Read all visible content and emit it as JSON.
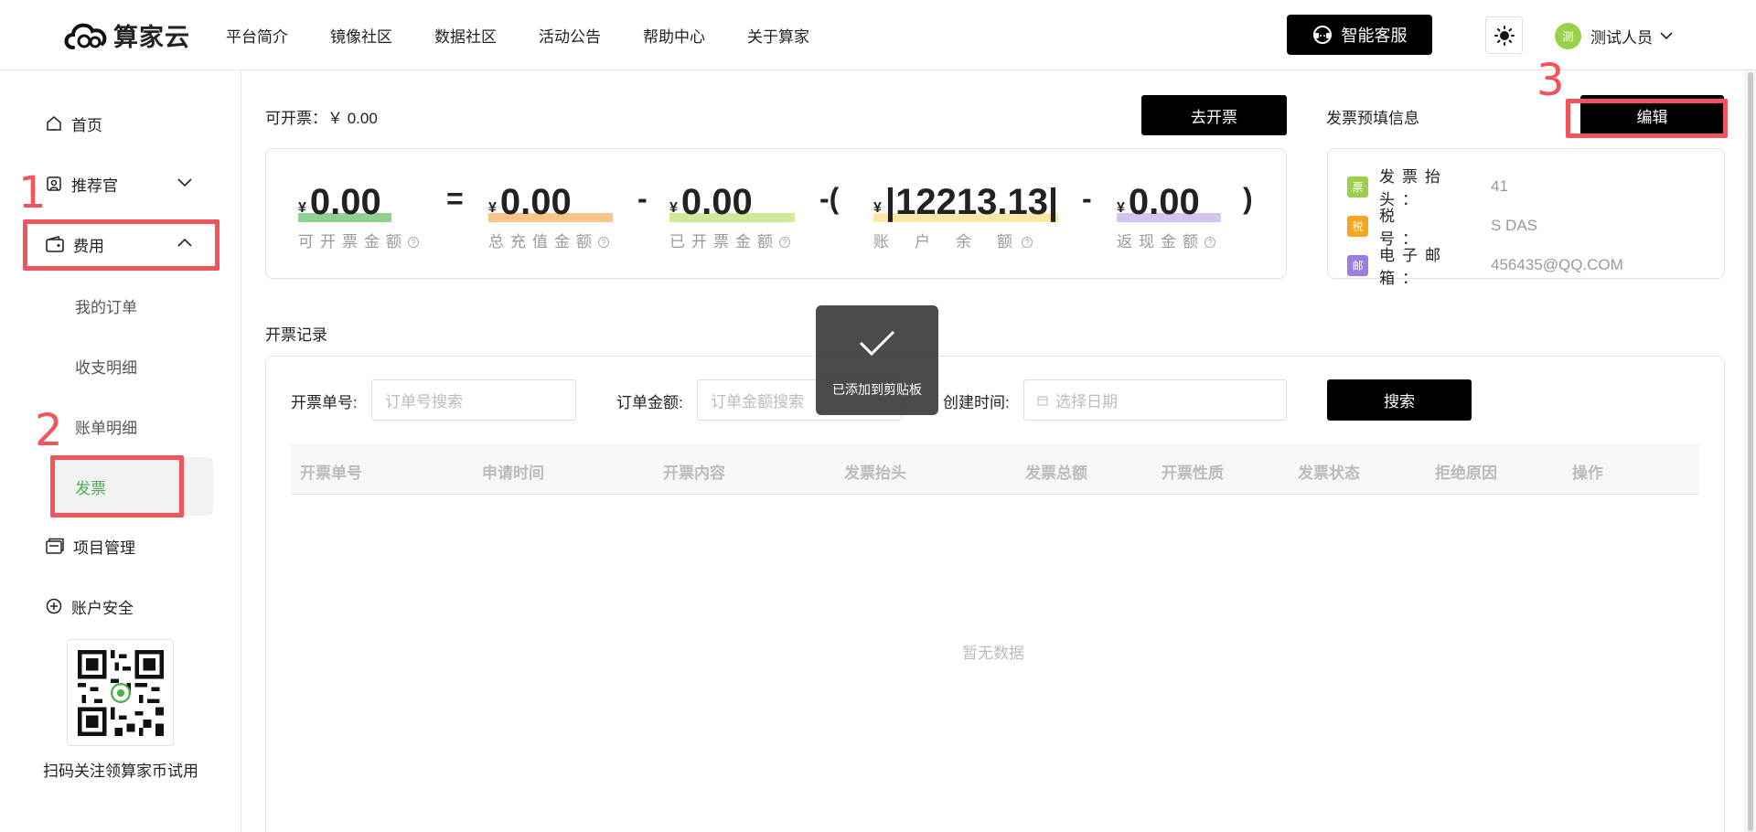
{
  "header": {
    "brand": "算家云",
    "nav": [
      "平台简介",
      "镜像社区",
      "数据社区",
      "活动公告",
      "帮助中心",
      "关于算家"
    ],
    "service_label": "智能客服",
    "user_name": "测试人员",
    "avatar_text": "测"
  },
  "sidebar": {
    "home": "首页",
    "recommender": "推荐官",
    "fees": "费用",
    "my_orders": "我的订单",
    "income_expense": "收支明细",
    "bill_details": "账单明细",
    "invoice": "发票",
    "project_mgmt": "项目管理",
    "account_security": "账户安全",
    "qr_caption": "扫码关注领算家币试用"
  },
  "annotations": {
    "n1": "1",
    "n2": "2",
    "n3": "3"
  },
  "summary": {
    "available_label": "可开票：￥ 0.00",
    "go_invoice": "去开票",
    "currency": "¥",
    "metrics": [
      {
        "value": "0.00",
        "label": "可开票金额"
      },
      {
        "value": "0.00",
        "label": "总充值金额"
      },
      {
        "value": "0.00",
        "label": "已开票金额"
      },
      {
        "value": "|12213.13|",
        "label": "账户余额"
      },
      {
        "value": "0.00",
        "label": "返现金额"
      }
    ],
    "ops": {
      "eq": "=",
      "minus": "-",
      "minus_paren": "-(",
      "close_paren": ")"
    },
    "help_mark": "?"
  },
  "invoice_info": {
    "title": "发票预填信息",
    "edit": "编辑",
    "rows": [
      {
        "badge": "票",
        "label": "发票抬头：",
        "value": "41"
      },
      {
        "badge": "税",
        "label": "税　　号：",
        "value": "S DAS"
      },
      {
        "badge": "邮",
        "label": "电子邮箱：",
        "value": "456435@QQ.COM"
      }
    ]
  },
  "records": {
    "title": "开票记录",
    "filters": {
      "order_no_label": "开票单号:",
      "order_no_placeholder": "订单号搜索",
      "amount_label": "订单金额:",
      "amount_placeholder": "订单金额搜索",
      "date_label": "创建时间:",
      "date_placeholder": "选择日期",
      "search": "搜索"
    },
    "columns": [
      "开票单号",
      "申请时间",
      "开票内容",
      "发票抬头",
      "发票总额",
      "开票性质",
      "发票状态",
      "拒绝原因",
      "操作"
    ],
    "empty": "暂无数据"
  },
  "toast": "已添加到剪贴板",
  "colors": {
    "accent_red": "#f2545b",
    "bar_green": "#8fd18f",
    "bar_orange": "#f9c58a",
    "bar_lime": "#cdeb99",
    "bar_yellow": "#fbe8a6",
    "bar_purple": "#d4c4f2",
    "invoice_green": "#4caf50"
  }
}
